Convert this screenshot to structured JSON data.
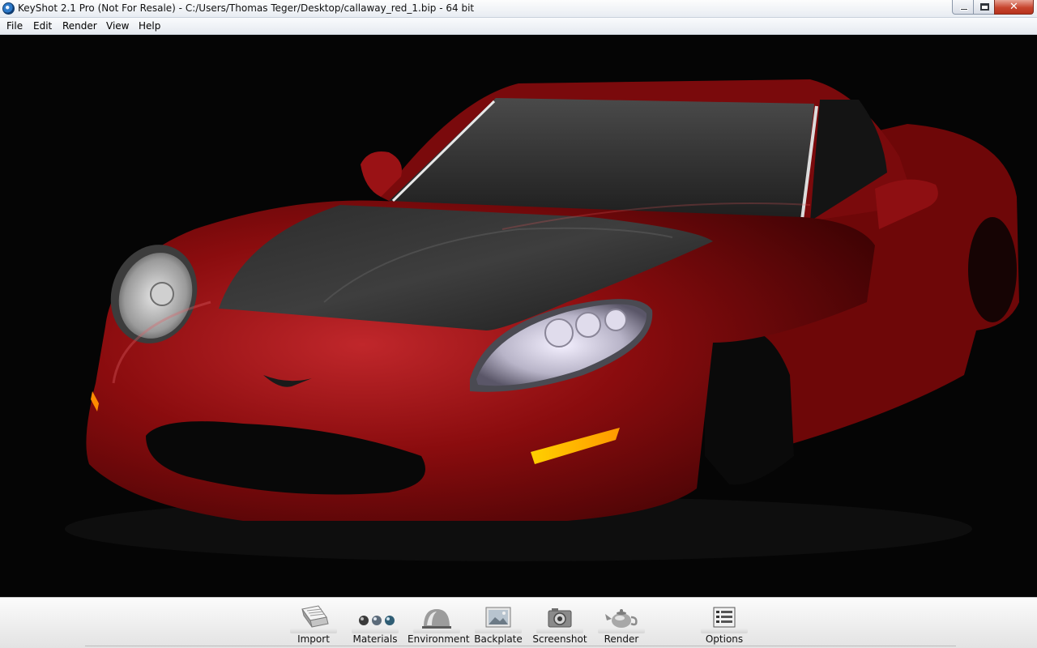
{
  "window": {
    "title": "KeyShot 2.1 Pro (Not For Resale)  - C:/Users/Thomas Teger/Desktop/callaway_red_1.bip  - 64 bit",
    "icon": "keyshot-app-icon",
    "buttons": {
      "minimize_icon": "minimize-icon",
      "maximize_icon": "restore-icon",
      "close": "✕"
    }
  },
  "menu": {
    "items": [
      {
        "label": "File"
      },
      {
        "label": "Edit"
      },
      {
        "label": "Render"
      },
      {
        "label": "View"
      },
      {
        "label": "Help"
      }
    ]
  },
  "viewport": {
    "content": "rendered-car-model",
    "background_color": "#050505",
    "accent_body_color": "#8a0c0e"
  },
  "toolbar": {
    "items": [
      {
        "label": "Import",
        "icon": "import-icon"
      },
      {
        "label": "Materials",
        "icon": "materials-icon"
      },
      {
        "label": "Environment",
        "icon": "environment-icon"
      },
      {
        "label": "Backplate",
        "icon": "backplate-icon"
      },
      {
        "label": "Screenshot",
        "icon": "camera-icon"
      },
      {
        "label": "Render",
        "icon": "teapot-icon"
      },
      {
        "label": "Options",
        "icon": "options-icon"
      }
    ]
  }
}
